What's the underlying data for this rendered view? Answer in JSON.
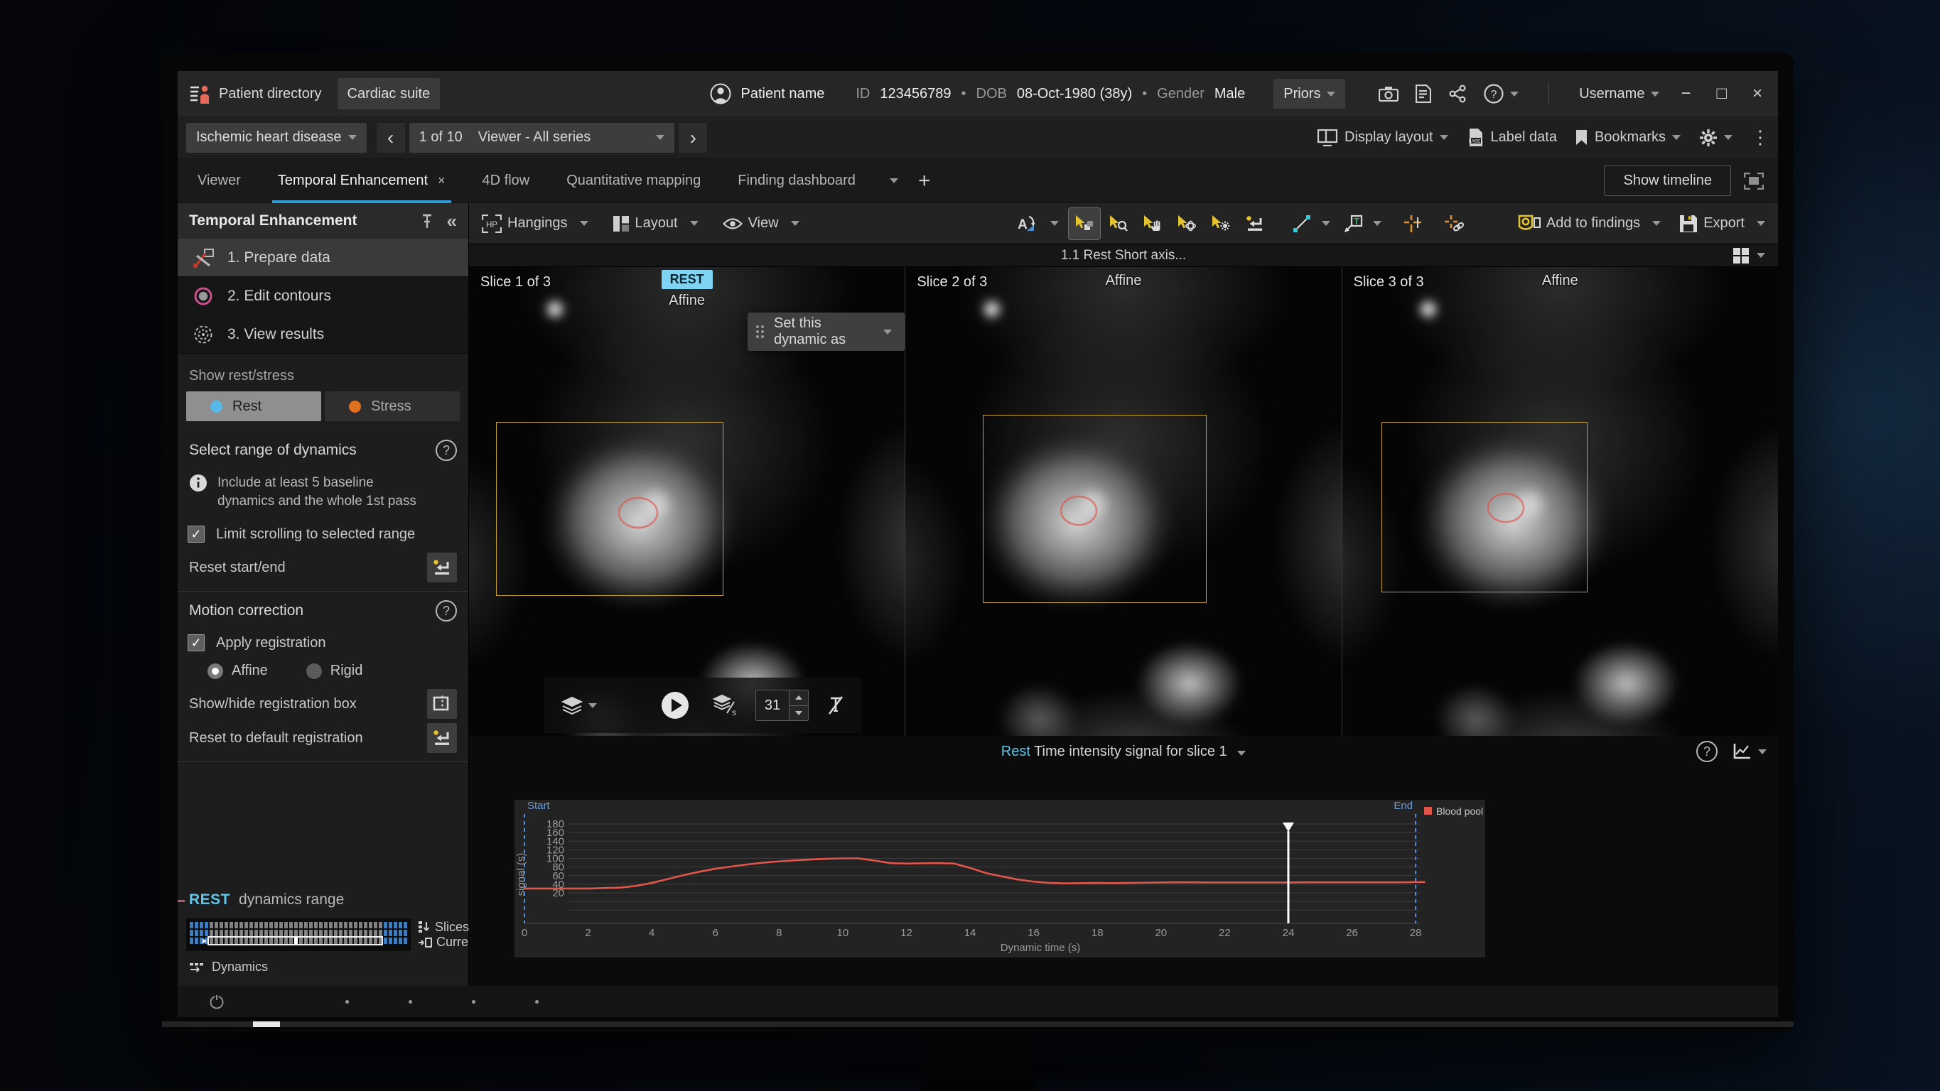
{
  "colors": {
    "accent_cyan": "#62c6ea",
    "rest_dot": "#56b9e8",
    "stress_dot": "#e07020",
    "tab_underline": "#2f9bd6",
    "blood_pool": "#e0564a",
    "range_marker": "#5b8fd9",
    "current_marker": "#ffffff",
    "reg_box": "#c9a227",
    "rest_badge_bg": "#7fd3f3"
  },
  "titlebar": {
    "patient_directory": "Patient directory",
    "cardiac_suite": "Cardiac suite",
    "patient": {
      "name": "Patient name",
      "id_label": "ID",
      "id": "123456789",
      "dob_label": "DOB",
      "dob": "08-Oct-1980 (38y)",
      "gender_label": "Gender",
      "gender": "Male"
    },
    "priors": "Priors",
    "username": "Username",
    "minimize": "−",
    "maximize": "□",
    "close": "×"
  },
  "navbar": {
    "exam_dropdown": "Ischemic heart disease",
    "prev": "‹",
    "counter": "1 of 10",
    "series_dropdown": "Viewer - All series",
    "next": "›",
    "display_layout": "Display layout",
    "label_data": "Label data",
    "bookmarks": "Bookmarks"
  },
  "tabs": {
    "items": [
      {
        "label": "Viewer"
      },
      {
        "label": "Temporal Enhancement",
        "close": "×"
      },
      {
        "label": "4D flow"
      },
      {
        "label": "Quantitative mapping"
      },
      {
        "label": "Finding dashboard"
      }
    ],
    "add": "+",
    "show_timeline": "Show timeline"
  },
  "sidebar": {
    "title": "Temporal Enhancement",
    "collapse": "«",
    "steps": [
      {
        "label": "1. Prepare data"
      },
      {
        "label": "2. Edit contours"
      },
      {
        "label": "3. View results"
      }
    ],
    "show_rest_stress": "Show rest/stress",
    "rest": "Rest",
    "stress": "Stress",
    "select_range_title": "Select range of dynamics",
    "info_text": "Include at least 5 baseline dynamics and the whole 1st pass",
    "limit_scrolling": "Limit scrolling to selected range",
    "checkmark": "✓",
    "reset_start_end": "Reset start/end",
    "motion_correction": "Motion correction",
    "apply_registration": "Apply registration",
    "affine": "Affine",
    "rigid": "Rigid",
    "show_hide_box": "Show/hide registration box",
    "reset_default_reg": "Reset to default registration",
    "rest_label": "REST",
    "dynamics_range_label": "dynamics range",
    "slices_label": "Slices",
    "current_label": "Current",
    "dynamics_label": "Dynamics",
    "range_widget": {
      "columns": 44,
      "rows": 3,
      "blue_left": 4,
      "blue_right": 5,
      "selection_row": 2,
      "current_col": 21
    },
    "help_glyph": "?"
  },
  "toolbar": {
    "hangings": "Hangings",
    "hp": "HP",
    "layout": "Layout",
    "view": "View",
    "add_to_findings": "Add to findings",
    "export": "Export"
  },
  "viewer": {
    "series_title": "1.1 Rest Short axis...",
    "set_dynamic": "Set this dynamic as",
    "dynamic_value": "31",
    "slices": [
      {
        "label": "Slice 1 of 3",
        "badge": "REST",
        "registration": "Affine"
      },
      {
        "label": "Slice 2 of 3",
        "registration": "Affine"
      },
      {
        "label": "Slice 3 of 3",
        "registration": "Affine"
      }
    ]
  },
  "chart": {
    "title_prefix": "Rest",
    "title_rest": "Time intensity signal for slice 1",
    "help_glyph": "?"
  },
  "chart_data": {
    "type": "line",
    "title": "Rest Time intensity signal for slice 1",
    "xlabel": "Dynamic time (s)",
    "ylabel": "signal (s)",
    "xlim": [
      0,
      28.6
    ],
    "ylim": [
      -40,
      190
    ],
    "xticks": [
      0,
      2,
      4,
      6,
      8,
      10,
      12,
      14,
      16,
      18,
      20,
      22,
      24,
      26,
      28
    ],
    "yticks": [
      20,
      40,
      60,
      80,
      100,
      120,
      140,
      160,
      180
    ],
    "ygrid_values": [
      180,
      160,
      140,
      120,
      100,
      80,
      60,
      40,
      20,
      0,
      -20
    ],
    "grid": true,
    "legend_position": "top-right",
    "markers": {
      "start": 0,
      "end": 28,
      "current": 24,
      "start_label": "Start",
      "end_label": "End"
    },
    "series": [
      {
        "name": "Blood pool",
        "color": "#e0564a",
        "x": [
          0,
          0.5,
          1,
          1.5,
          2,
          2.5,
          3,
          3.5,
          4,
          4.5,
          5,
          5.5,
          6,
          6.5,
          7,
          7.5,
          8,
          8.5,
          9,
          9.5,
          10,
          10.5,
          11,
          11.5,
          12,
          12.5,
          13,
          13.5,
          14,
          14.5,
          15,
          15.5,
          16,
          16.5,
          17,
          17.5,
          18,
          18.5,
          19,
          19.5,
          20,
          20.5,
          21,
          21.5,
          22,
          22.5,
          23,
          23.5,
          24,
          24.5,
          25,
          25.5,
          26,
          26.5,
          27,
          27.5,
          28,
          28.3
        ],
        "y": [
          30,
          30,
          30,
          30,
          30,
          31,
          32,
          36,
          43,
          52,
          61,
          69,
          76,
          81,
          86,
          90,
          93,
          95.5,
          97.5,
          99,
          100,
          100,
          95,
          89,
          88,
          88.5,
          89,
          88,
          78,
          66,
          58,
          51,
          46,
          43,
          42,
          42.5,
          43,
          42.5,
          43,
          43.5,
          44,
          44.5,
          44.5,
          44,
          44,
          44,
          44,
          44,
          44,
          44.5,
          44.5,
          44.5,
          44.5,
          44.5,
          44.5,
          44.5,
          45,
          45
        ]
      }
    ]
  },
  "bezel": {
    "power": "power"
  }
}
